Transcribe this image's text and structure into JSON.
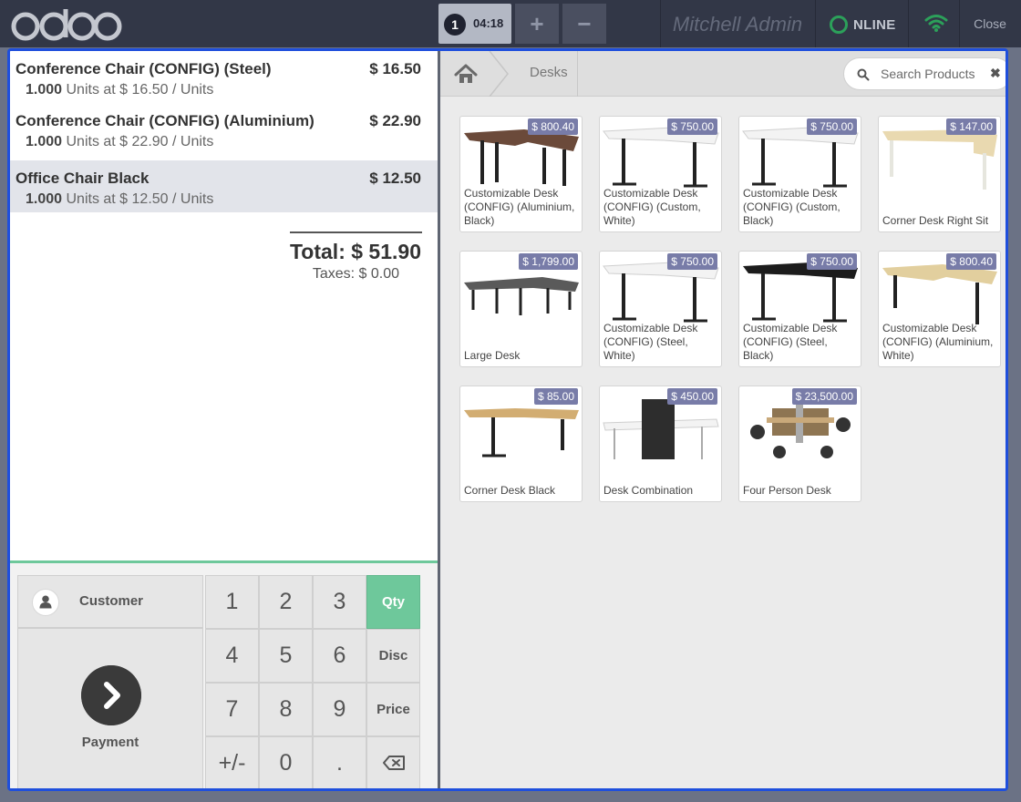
{
  "topbar": {
    "logo_text": "odoo",
    "order_number": "1",
    "order_time": "04:18",
    "add_order_label": "+",
    "remove_order_label": "−",
    "cashier_name": "Mitchell Admin",
    "status_text": "NLINE",
    "close_label": "Close"
  },
  "orderlines": [
    {
      "name": "Conference Chair (CONFIG) (Steel)",
      "price": "$ 16.50",
      "qty": "1.000",
      "info": " Units at $ 16.50 / Units"
    },
    {
      "name": "Conference Chair (CONFIG) (Aluminium)",
      "price": "$ 22.90",
      "qty": "1.000",
      "info": " Units at $ 22.90 / Units"
    },
    {
      "name": "Office Chair Black",
      "price": "$ 12.50",
      "qty": "1.000",
      "info": " Units at $ 12.50 / Units",
      "selected": true
    }
  ],
  "summary": {
    "total": "Total: $ 51.90",
    "taxes": "Taxes: $ 0.00"
  },
  "actionpad": {
    "customer_label": "Customer",
    "payment_label": "Payment"
  },
  "numpad": {
    "keys": [
      "1",
      "2",
      "3",
      "Qty",
      "4",
      "5",
      "6",
      "Disc",
      "7",
      "8",
      "9",
      "Price",
      "+/-",
      "0",
      "."
    ],
    "active_mode": "Qty"
  },
  "breadcrumb": {
    "category": "Desks"
  },
  "search": {
    "placeholder": "Search Products"
  },
  "products": [
    {
      "name": "Customizable Desk (CONFIG) (Aluminium, Black)",
      "price": "$ 800.40"
    },
    {
      "name": "Customizable Desk (CONFIG) (Custom, White)",
      "price": "$ 750.00"
    },
    {
      "name": "Customizable Desk (CONFIG) (Custom, Black)",
      "price": "$ 750.00"
    },
    {
      "name": "Corner Desk Right Sit",
      "price": "$ 147.00"
    },
    {
      "name": "Large Desk",
      "price": "$ 1,799.00"
    },
    {
      "name": "Customizable Desk (CONFIG) (Steel, White)",
      "price": "$ 750.00"
    },
    {
      "name": "Customizable Desk (CONFIG) (Steel, Black)",
      "price": "$ 750.00"
    },
    {
      "name": "Customizable Desk (CONFIG) (Aluminium, White)",
      "price": "$ 800.40"
    },
    {
      "name": "Corner Desk Black",
      "price": "$ 85.00"
    },
    {
      "name": "Desk Combination",
      "price": "$ 450.00"
    },
    {
      "name": "Four Person Desk",
      "price": "$ 23,500.00"
    }
  ],
  "colors": {
    "topbar": "#323747",
    "frame_border": "#1f4fdc",
    "accent_green": "#6ec89b",
    "price_badge": "#787ca8",
    "online_green": "#2ca05a"
  }
}
